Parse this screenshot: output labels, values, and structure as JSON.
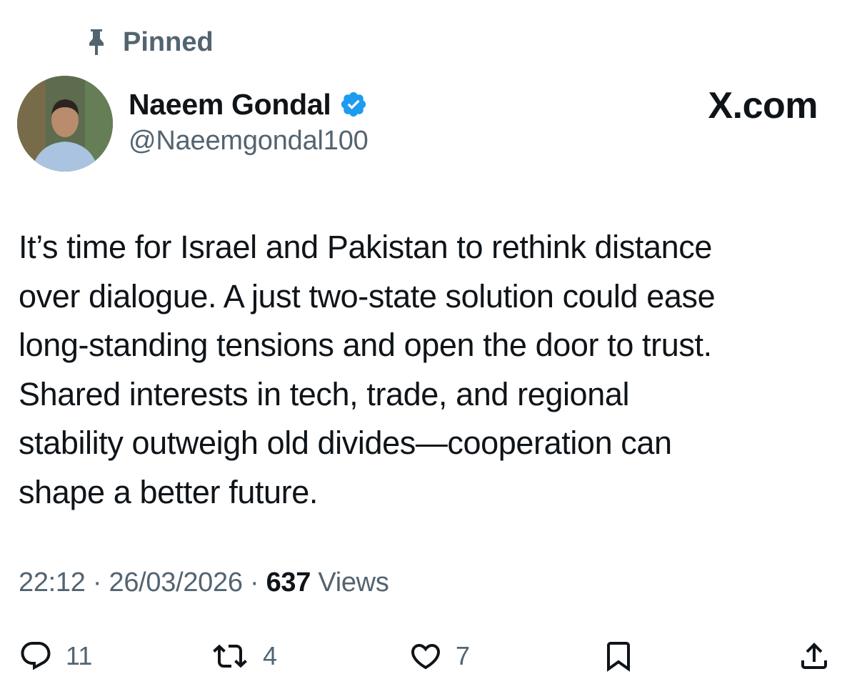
{
  "header": {
    "pinned_label": "Pinned",
    "watermark": "X.com"
  },
  "author": {
    "display_name": "Naeem Gondal",
    "handle": "@Naeemgondal100",
    "verified": true
  },
  "tweet": {
    "lines": [
      "It’s time for Israel and Pakistan to rethink distance",
      "over dialogue. A just two-state solution could ease",
      "long-standing tensions and open the door to trust.",
      "Shared interests in tech, trade, and regional",
      "stability outweigh old divides—cooperation can",
      "shape a better future."
    ]
  },
  "meta": {
    "time": "22:12",
    "date": "26/03/2026",
    "separator": "·",
    "views_count": "637",
    "views_label": "Views"
  },
  "actions": {
    "replies": "11",
    "reposts": "4",
    "likes": "7"
  },
  "colors": {
    "text_primary": "#0f1419",
    "text_secondary": "#536471",
    "verified_blue": "#1d9bf0"
  },
  "icons": {
    "pin": "pin-icon",
    "verified": "verified-badge-icon",
    "reply": "reply-icon",
    "repost": "repost-icon",
    "like": "heart-icon",
    "bookmark": "bookmark-icon",
    "share": "share-icon"
  }
}
